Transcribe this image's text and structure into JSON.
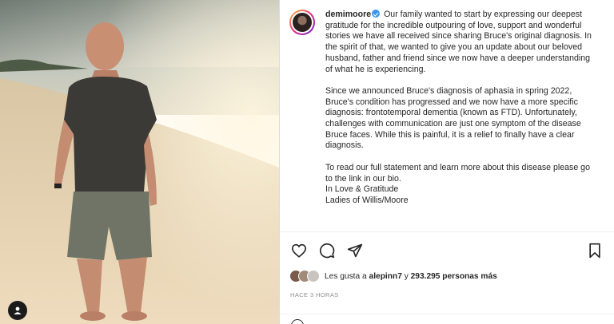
{
  "post": {
    "username": "demimoore",
    "caption_first_line": "Our family wanted to start by expressing our deepest gratitude for the incredible outpouring of love, support and wonderful stories we have all received since sharing Bruce's original diagnosis. In the spirit of that, we wanted to give you an update about our beloved husband, father and friend since we now have a deeper understanding of what he is experiencing.",
    "caption_para2": "Since we announced Bruce's diagnosis of aphasia in spring 2022, Bruce's condition has progressed and we now have a more specific diagnosis: frontotemporal dementia (known as FTD). Unfortunately, challenges with communication are just one symptom of the disease Bruce faces. While this is painful, it is a relief to finally have a clear diagnosis.",
    "caption_para3_line1": "To read our full statement and learn more about this disease please go to the link in our bio.",
    "caption_para3_line2": "In Love & Gratitude",
    "caption_para3_line3": "Ladies of Willis/Moore"
  },
  "likes": {
    "prefix": "Les gusta a",
    "liker": "alepinn7",
    "joiner": "y",
    "count_text": "293.295 personas más"
  },
  "timestamp": "HACE 3 HORAS",
  "icons": {
    "like": "heart-icon",
    "comment": "comment-icon",
    "share": "send-icon",
    "save": "bookmark-icon",
    "tags": "person-tag-icon",
    "verified": "verified-badge-icon"
  },
  "colors": {
    "verified": "#3897f0",
    "text": "#262626",
    "muted": "#8e8e8e"
  }
}
